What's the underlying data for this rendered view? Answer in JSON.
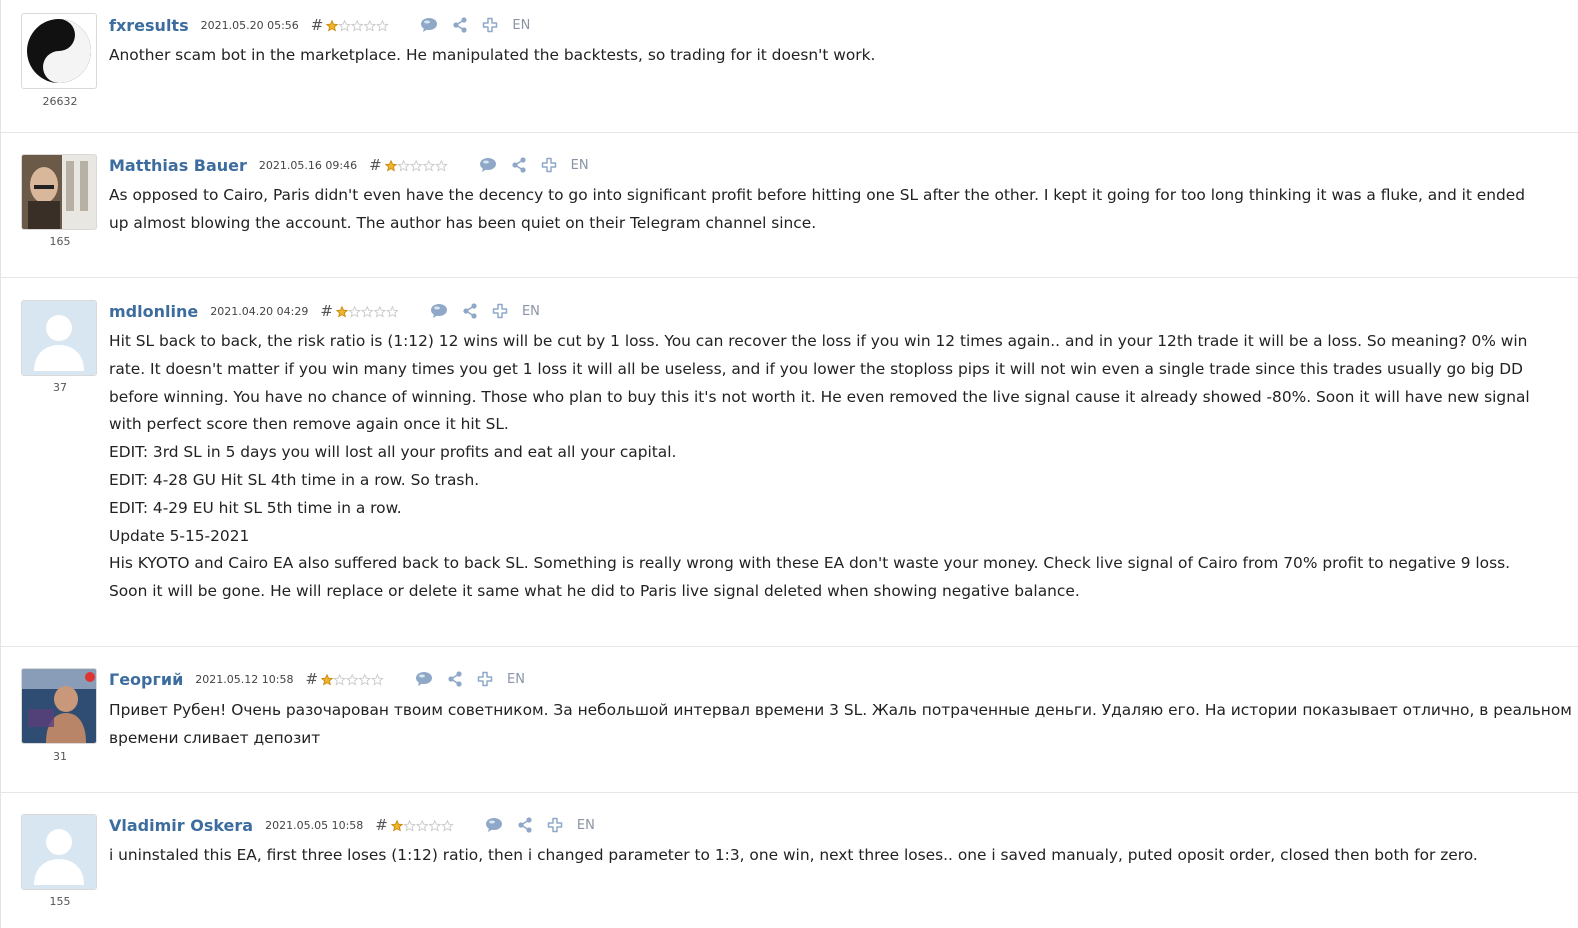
{
  "reviews": [
    {
      "author": "fxresults",
      "date": "2021.05.20 05:56",
      "hash": "#",
      "rating_count": "26632",
      "stars": 1,
      "language": "EN",
      "avatar": "yin-yang-heart-avatar",
      "lines": [
        "Another scam bot in the marketplace. He manipulated the backtests, so trading for it doesn't work."
      ]
    },
    {
      "author": "Matthias Bauer",
      "date": "2021.05.16 09:46",
      "hash": "#",
      "rating_count": "165",
      "stars": 1,
      "language": "EN",
      "avatar": "photo-avatar-man",
      "lines": [
        "As opposed to Cairo, Paris didn't even have the decency to go into significant profit before hitting one SL after the other. I kept it going for too long thinking it was a fluke, and it ended",
        "up almost blowing the account. The author has been quiet on their Telegram channel since."
      ]
    },
    {
      "author": "mdlonline",
      "date": "2021.04.20 04:29",
      "hash": "#",
      "rating_count": "37",
      "stars": 1,
      "language": "EN",
      "avatar": "default-user-avatar",
      "lines": [
        "Hit SL back to back, the risk ratio is (1:12) 12 wins will be cut by 1 loss. You can recover the loss if you win 12 times again.. and in your 12th trade it will be a loss. So meaning? 0% win",
        "rate. It doesn't matter if you win many times you get 1 loss it will all be useless, and if you lower the stoploss pips it will not win even a single trade since this trades usually go big DD",
        "before winning. You have no chance of winning. Those who plan to buy this it's not worth it. He even removed the live signal cause it already showed -80%. Soon it will have new signal",
        "with perfect score then remove again once it hit SL.",
        "EDIT: 3rd SL in 5 days you will lost all your profits and eat all your capital.",
        "EDIT: 4-28 GU Hit SL 4th time in a row. So trash.",
        "EDIT: 4-29 EU hit SL 5th time in a row.",
        "Update 5-15-2021",
        "His KYOTO and Cairo EA also suffered back to back SL. Something is really wrong with these EA don't waste your money. Check live signal of Cairo from 70% profit to negative 9 loss.",
        "Soon it will be gone. He will replace or delete it same what he did to Paris live signal deleted when showing negative balance."
      ]
    },
    {
      "author": "Георгий",
      "date": "2021.05.12 10:58",
      "hash": "#",
      "rating_count": "31",
      "stars": 1,
      "language": "EN",
      "avatar": "photo-avatar-child",
      "lines": [
        "Привет Рубен! Очень разочарован твоим советником. За небольшой интервал времени 3 SL. Жаль потраченные деньги. Удаляю его. На истории показывает отлично, в реальном",
        "времени сливает депозит"
      ]
    },
    {
      "author": "Vladimir Oskera",
      "date": "2021.05.05 10:58",
      "hash": "#",
      "rating_count": "155",
      "stars": 1,
      "language": "EN",
      "avatar": "default-user-avatar",
      "lines": [
        "i uninstaled this EA, first three loses (1:12) ratio, then i changed parameter to 1:3, one win, next three loses.. one i saved manualy, puted oposit order, closed then both for zero."
      ]
    }
  ],
  "icons": [
    "comment-icon",
    "share-icon",
    "add-icon"
  ],
  "colors": {
    "author": "#3d6d9e",
    "star_filled": "#f0b429",
    "star_empty": "#c9c9c9",
    "icon": "#8fa8c8",
    "divider": "#e6e6e6"
  }
}
